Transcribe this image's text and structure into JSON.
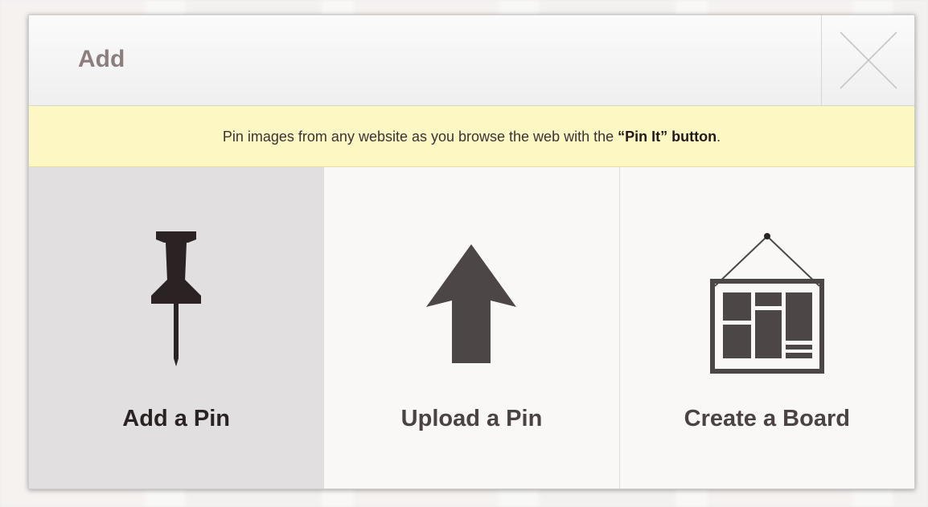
{
  "modal": {
    "title": "Add",
    "close_icon": "close-x-icon"
  },
  "notice": {
    "text_before": "Pin images from any website as you browse the web with the ",
    "highlight": "“Pin It” button",
    "text_after": "."
  },
  "options": [
    {
      "label": "Add a Pin",
      "icon": "pushpin-icon",
      "active": true
    },
    {
      "label": "Upload a Pin",
      "icon": "upload-arrow-icon",
      "active": false
    },
    {
      "label": "Create a Board",
      "icon": "board-icon",
      "active": false
    }
  ],
  "colors": {
    "title": "#8c7e7e",
    "notice_bg": "#fdf7c3",
    "active_bg": "#e1dfdf",
    "icon": "#4d4646"
  }
}
